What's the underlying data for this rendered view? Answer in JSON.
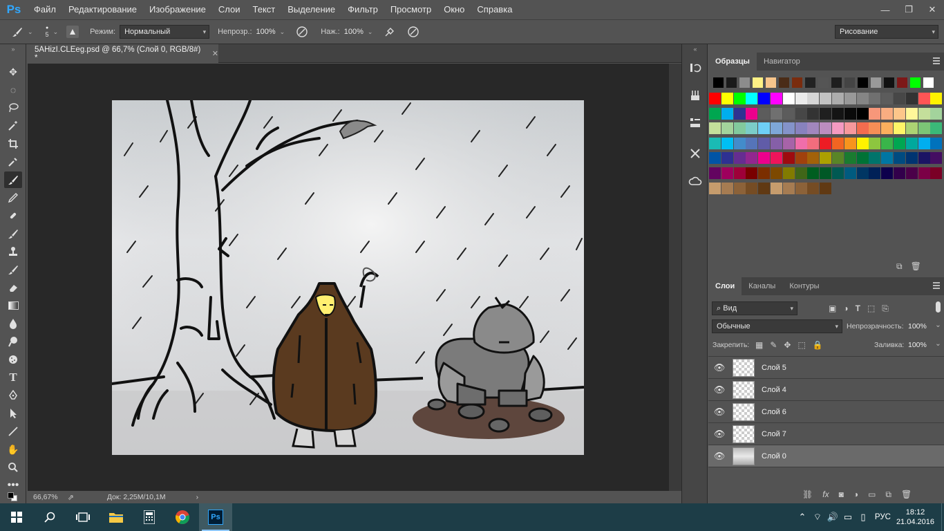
{
  "app": {
    "logo": "Ps"
  },
  "menu": [
    "Файл",
    "Редактирование",
    "Изображение",
    "Слои",
    "Текст",
    "Выделение",
    "Фильтр",
    "Просмотр",
    "Окно",
    "Справка"
  ],
  "options": {
    "brush_size": "5",
    "mode_label": "Режим:",
    "mode_value": "Нормальный",
    "opacity_label": "Непрозр.:",
    "opacity_value": "100%",
    "flow_label": "Наж.:",
    "flow_value": "100%",
    "workspace": "Рисование"
  },
  "document": {
    "tab_title": "5AHizI.CLEeg.psd @ 66,7% (Слой 0, RGB/8#) *",
    "zoom": "66,67%",
    "doc_size": "Док: 2,25M/10,1M"
  },
  "swatches_panel": {
    "tabs": [
      "Образцы",
      "Навигатор"
    ],
    "recent": [
      "#000000",
      "#1a1a1a",
      "#8c8c8c",
      "#fef185",
      "#f7c58b",
      "#4a2c17",
      "#7a2c0e",
      "#222222",
      "#555555",
      "#1e1e1e",
      "#444444",
      "#000000",
      "#999999",
      "#111111",
      "#7d1818",
      "#00ff00",
      "#ffffff"
    ],
    "grid": [
      [
        "#ff0000",
        "#ffff00",
        "#00ff00",
        "#00ffff",
        "#0000ff",
        "#ff00ff",
        "#ffffff",
        "#ebebeb",
        "#d6d6d6",
        "#c2c2c2",
        "#adadad",
        "#999999",
        "#858585",
        "#707070",
        "#5c5c5c",
        "#474747",
        "#333333",
        "#ff5555",
        "#fff200"
      ],
      [
        "#00a650",
        "#00aeef",
        "#2e3192",
        "#ec008c",
        "#5c5c5c",
        "#707070",
        "#5c5c5c",
        "#474747",
        "#333333",
        "#1f1f1f",
        "#141414",
        "#0a0a0a",
        "#000000",
        "#f7977a",
        "#f9ad81",
        "#fdc68a",
        "#fff79a",
        "#c4df9b",
        "#a3d39c"
      ],
      [
        "#c4df9b",
        "#a3d39c",
        "#82ca9d",
        "#7bcdc8",
        "#6ecff6",
        "#7ea7d8",
        "#8493ca",
        "#8882be",
        "#a187be",
        "#bc8dbf",
        "#f49ac2",
        "#f6989d",
        "#f26c4f",
        "#f68e56",
        "#fbaf5d",
        "#fff568",
        "#acd373",
        "#7cc576",
        "#3bb878"
      ],
      [
        "#1abbb4",
        "#00bff3",
        "#438ccb",
        "#5574b9",
        "#605ca8",
        "#855fa8",
        "#a763a8",
        "#f06eaa",
        "#f26d7d",
        "#ed1c24",
        "#f26522",
        "#f7941d",
        "#fff200",
        "#8dc63f",
        "#39b54a",
        "#00a651",
        "#00a99d",
        "#00aeef",
        "#0072bc"
      ],
      [
        "#0054a6",
        "#2e3192",
        "#662d91",
        "#92278f",
        "#ec008c",
        "#ed145b",
        "#9e0b0f",
        "#a0410d",
        "#a36209",
        "#aba000",
        "#598527",
        "#1a7b30",
        "#007236",
        "#00746b",
        "#0076a3",
        "#004b80",
        "#003471",
        "#1b1464",
        "#440e62"
      ],
      [
        "#630460",
        "#9e005d",
        "#9e0039",
        "#790000",
        "#7b2e00",
        "#7d4900",
        "#827b00",
        "#406618",
        "#005e20",
        "#005826",
        "#005952",
        "#005b7f",
        "#003663",
        "#002157",
        "#0d004c",
        "#32004b",
        "#4b0049",
        "#7b0046",
        "#7a0026"
      ],
      [
        "#c69c6d",
        "#a67c52",
        "#8c6239",
        "#754c24",
        "#603913",
        "#c69c6d",
        "#a67c52",
        "#8c6239",
        "#754c24",
        "#603913"
      ]
    ]
  },
  "layers_panel": {
    "tabs": [
      "Слои",
      "Каналы",
      "Контуры"
    ],
    "filter": "Вид",
    "blend_mode": "Обычные",
    "opacity_label": "Непрозрачность:",
    "opacity_value": "100%",
    "lock_label": "Закрепить:",
    "fill_label": "Заливка:",
    "fill_value": "100%",
    "layers": [
      {
        "name": "Слой 5",
        "selected": false
      },
      {
        "name": "Слой 4",
        "selected": false
      },
      {
        "name": "Слой 6",
        "selected": false
      },
      {
        "name": "Слой 7",
        "selected": false
      },
      {
        "name": "Слой 0",
        "selected": true
      }
    ]
  },
  "taskbar": {
    "language": "РУС",
    "time": "18:12",
    "date": "21.04.2016"
  }
}
